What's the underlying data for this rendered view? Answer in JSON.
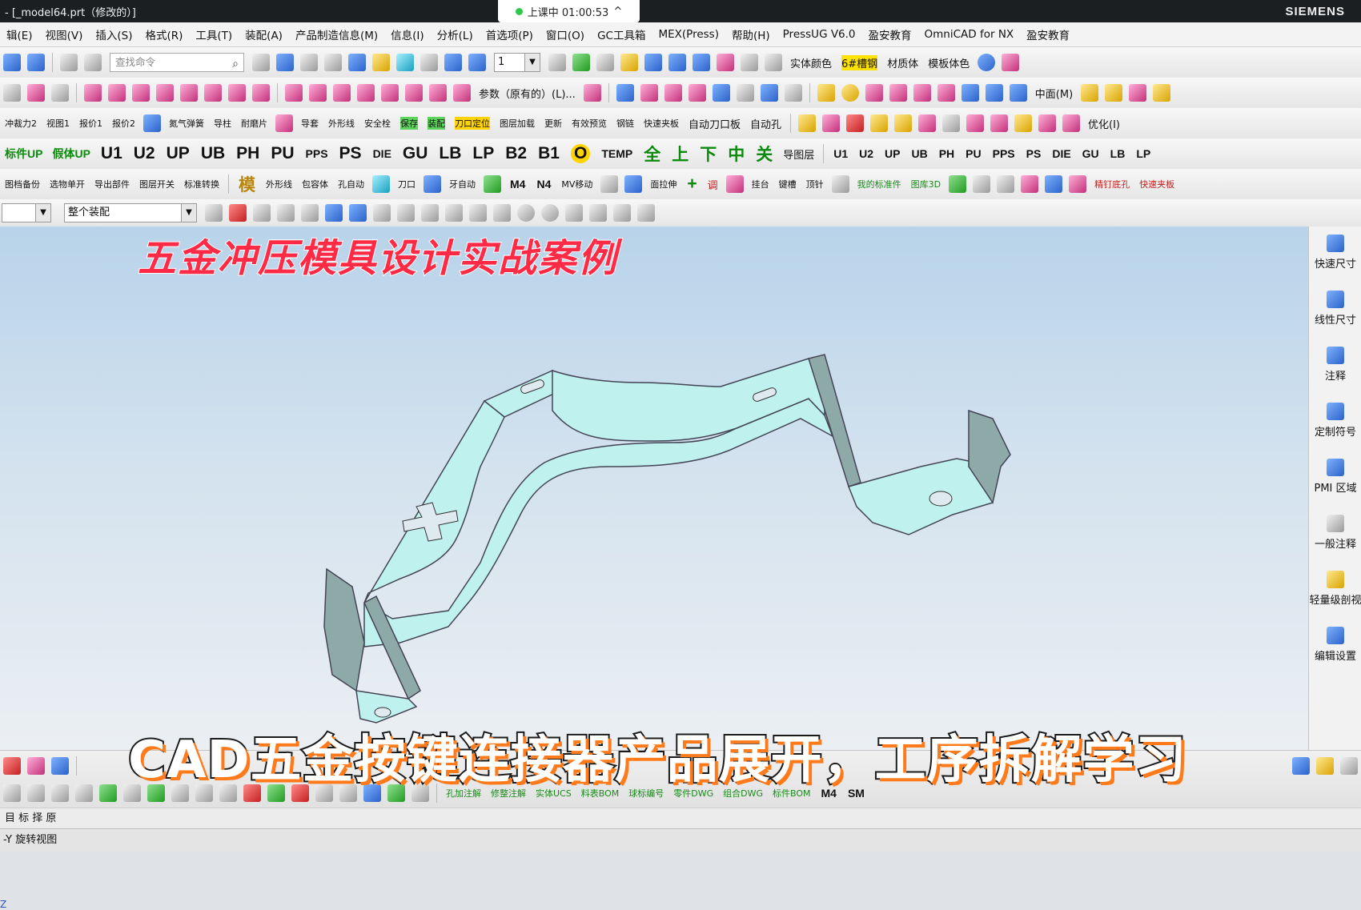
{
  "window": {
    "title": "- [_model64.prt（修改的）]",
    "brand": "SIEMENS"
  },
  "session": {
    "status": "上课中 01:00:53",
    "chevron": "^"
  },
  "menu": [
    "辑(E)",
    "视图(V)",
    "插入(S)",
    "格式(R)",
    "工具(T)",
    "装配(A)",
    "产品制造信息(M)",
    "信息(I)",
    "分析(L)",
    "首选项(P)",
    "窗口(O)",
    "GC工具箱",
    "MEX(Press)",
    "帮助(H)",
    "PressUG V6.0",
    "盈安教育",
    "OmniCAD for NX",
    "盈安教育"
  ],
  "toolbar": {
    "search_placeholder": "查找命令",
    "layer_value": "1",
    "labels_row1": [
      "实体颜色",
      "6#槽钢",
      "材质体",
      "模板体色"
    ],
    "param_label": "参数（原有的）(L)...",
    "midplane_label": "中面(M)",
    "row3_labels": [
      "冲裁力2",
      "视图1",
      "报价1",
      "报价2",
      "氮气弹簧",
      "导柱",
      "耐磨片",
      "导套",
      "外形线",
      "安全栓",
      "保存",
      "装配",
      "刀口定位",
      "图层加载",
      "更新",
      "有效预览",
      "钢链",
      "快速夹板",
      "自动刀口板",
      "自动孔",
      "优化(I)"
    ],
    "commands": [
      "U1",
      "U2",
      "UP",
      "UB",
      "PH",
      "PU",
      "PPS",
      "PS",
      "DIE",
      "GU",
      "LB",
      "LP",
      "B2",
      "B1",
      "O",
      "TEMP",
      "全",
      "上",
      "下",
      "中",
      "关"
    ],
    "row4_prefix": [
      "标件UP",
      "假体UP"
    ],
    "row4_suffix_label": "导图层",
    "row4_small": [
      "U1",
      "U2",
      "UP",
      "UB",
      "PH",
      "PU",
      "PPS",
      "PS",
      "DIE",
      "GU",
      "LB",
      "LP"
    ],
    "row5_labels": [
      "图档备份",
      "选物单开",
      "导出部件",
      "图层开关",
      "标准转换",
      "模",
      "外形线",
      "包容体",
      "孔自动",
      "刀口",
      "牙自动",
      "M4",
      "N4",
      "MV移动",
      "面拉伸",
      "调",
      "挂台",
      "键槽",
      "顶针",
      "我的标准件",
      "图库3D",
      "精钉底孔",
      "快速夹板"
    ],
    "row6_dropdown": "整个装配"
  },
  "right_panel": [
    "快速尺寸",
    "线性尺寸",
    "注释",
    "定制符号",
    "PMI 区域",
    "一般注释",
    "轻量级剖视",
    "编辑设置"
  ],
  "overlay": {
    "title": "五金冲压模具设计实战案例",
    "subtitle": "CAD五金按键连接器产品展开，工序拆解学习"
  },
  "bottom_toolbar": {
    "labels": [
      "孔加注解",
      "修整注解",
      "实体UCS",
      "料表BOM",
      "球标编号",
      "零件DWG",
      "组合DWG",
      "标件BOM",
      "M4",
      "SM"
    ]
  },
  "minibar": "目 标 择 原",
  "status": "-Y 旋转视图",
  "axis_label": "Z"
}
